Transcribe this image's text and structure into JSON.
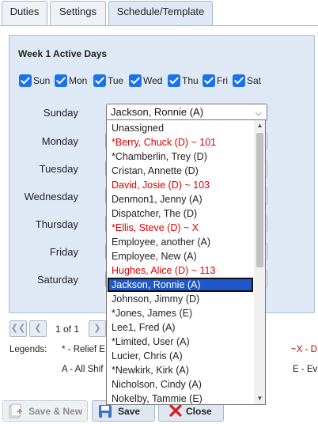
{
  "tabs": [
    {
      "label": "Duties"
    },
    {
      "label": "Settings"
    },
    {
      "label": "Schedule/Template"
    }
  ],
  "week": {
    "title": "Week 1 Active Days",
    "days": [
      "Sun",
      "Mon",
      "Tue",
      "Wed",
      "Thu",
      "Fri",
      "Sat"
    ],
    "checked": [
      true,
      true,
      true,
      true,
      true,
      true,
      true
    ]
  },
  "schedule": {
    "day_labels": [
      "Sunday",
      "Monday",
      "Tuesday",
      "Wednesday",
      "Thursday",
      "Friday",
      "Saturday"
    ],
    "sunday_value": "Jackson, Ronnie (A)"
  },
  "dropdown": {
    "options": [
      {
        "label": "Unassigned",
        "red": false
      },
      {
        "label": "*Berry, Chuck (D) ~ 101",
        "red": true
      },
      {
        "label": "*Chamberlin, Trey (D)",
        "red": false
      },
      {
        "label": "Cristan, Annette (D)",
        "red": false
      },
      {
        "label": "David, Josie (D) ~ 103",
        "red": true
      },
      {
        "label": "Denmon1, Jenny (A)",
        "red": false
      },
      {
        "label": "Dispatcher, The (D)",
        "red": false
      },
      {
        "label": "*Ellis, Steve (D) ~ X",
        "red": true
      },
      {
        "label": "Employee, another (A)",
        "red": false
      },
      {
        "label": "Employee, New (A)",
        "red": false
      },
      {
        "label": "Hughes, Alice (D) ~ 113",
        "red": true
      },
      {
        "label": "Jackson, Ronnie (A)",
        "red": false,
        "selected": true
      },
      {
        "label": "Johnson, Jimmy (D)",
        "red": false
      },
      {
        "label": "*Jones, James (E)",
        "red": false
      },
      {
        "label": "Lee1, Fred (A)",
        "red": false
      },
      {
        "label": "*Limited, User (A)",
        "red": false
      },
      {
        "label": "Lucier, Chris (A)",
        "red": false
      },
      {
        "label": "*Newkirk, Kirk (A)",
        "red": false
      },
      {
        "label": "Nicholson, Cindy (A)",
        "red": false
      },
      {
        "label": "Nokelby, Tammie (E)",
        "red": false
      }
    ]
  },
  "pager": {
    "text": "1 of 1"
  },
  "legends": {
    "label": "Legends:",
    "relief": "* - Relief E",
    "all_shifts": "A - All Shif",
    "x_marker": "~X - D",
    "evening": "E - Ev"
  },
  "toolbar": {
    "save_new": "Save & New",
    "save": "Save",
    "close": "Close"
  },
  "colors": {
    "accent": "#1a73e8",
    "red_option": "#e00000",
    "selected_option": "#1e57c9",
    "panel": "#dfe9f5"
  },
  "icons": [
    "first-page-icon",
    "prev-page-icon",
    "next-page-icon",
    "save-new-icon",
    "save-icon",
    "close-icon",
    "chevron-down-icon"
  ]
}
